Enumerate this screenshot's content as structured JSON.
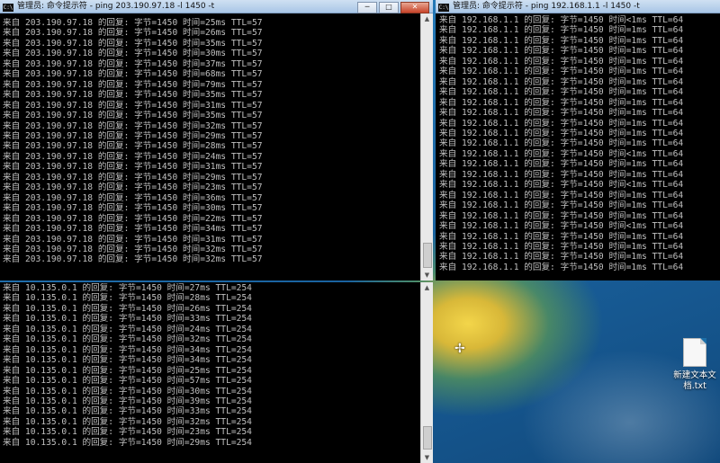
{
  "desktop": {
    "file_icon_label": "新建文本文档.txt",
    "cursor": "✢"
  },
  "icons": {
    "console": "C:\\",
    "minimize": "─",
    "maximize": "□",
    "close": "✕",
    "scroll_up": "▲",
    "scroll_down": "▼"
  },
  "window_left_top": {
    "title": "管理员: 命令提示符 - ping  203.190.97.18 -l 1450 -t",
    "lines": [
      "来自 203.190.97.18 的回复: 字节=1450 时间=25ms TTL=57",
      "来自 203.190.97.18 的回复: 字节=1450 时间=26ms TTL=57",
      "来自 203.190.97.18 的回复: 字节=1450 时间=35ms TTL=57",
      "来自 203.190.97.18 的回复: 字节=1450 时间=30ms TTL=57",
      "来自 203.190.97.18 的回复: 字节=1450 时间=37ms TTL=57",
      "来自 203.190.97.18 的回复: 字节=1450 时间=68ms TTL=57",
      "来自 203.190.97.18 的回复: 字节=1450 时间=79ms TTL=57",
      "来自 203.190.97.18 的回复: 字节=1450 时间=35ms TTL=57",
      "来自 203.190.97.18 的回复: 字节=1450 时间=31ms TTL=57",
      "来自 203.190.97.18 的回复: 字节=1450 时间=35ms TTL=57",
      "来自 203.190.97.18 的回复: 字节=1450 时间=32ms TTL=57",
      "来自 203.190.97.18 的回复: 字节=1450 时间=29ms TTL=57",
      "来自 203.190.97.18 的回复: 字节=1450 时间=28ms TTL=57",
      "来自 203.190.97.18 的回复: 字节=1450 时间=24ms TTL=57",
      "来自 203.190.97.18 的回复: 字节=1450 时间=31ms TTL=57",
      "来自 203.190.97.18 的回复: 字节=1450 时间=29ms TTL=57",
      "来自 203.190.97.18 的回复: 字节=1450 时间=23ms TTL=57",
      "来自 203.190.97.18 的回复: 字节=1450 时间=36ms TTL=57",
      "来自 203.190.97.18 的回复: 字节=1450 时间=30ms TTL=57",
      "来自 203.190.97.18 的回复: 字节=1450 时间=22ms TTL=57",
      "来自 203.190.97.18 的回复: 字节=1450 时间=34ms TTL=57",
      "来自 203.190.97.18 的回复: 字节=1450 时间=31ms TTL=57",
      "来自 203.190.97.18 的回复: 字节=1450 时间=32ms TTL=57",
      "来自 203.190.97.18 的回复: 字节=1450 时间=32ms TTL=57"
    ]
  },
  "window_right": {
    "title": "管理员: 命令提示符 - ping  192.168.1.1 -l 1450 -t",
    "lines": [
      "来自 192.168.1.1 的回复: 字节=1450 时间<1ms TTL=64",
      "来自 192.168.1.1 的回复: 字节=1450 时间=1ms TTL=64",
      "来自 192.168.1.1 的回复: 字节=1450 时间=1ms TTL=64",
      "来自 192.168.1.1 的回复: 字节=1450 时间=1ms TTL=64",
      "来自 192.168.1.1 的回复: 字节=1450 时间=1ms TTL=64",
      "来自 192.168.1.1 的回复: 字节=1450 时间=1ms TTL=64",
      "来自 192.168.1.1 的回复: 字节=1450 时间=1ms TTL=64",
      "来自 192.168.1.1 的回复: 字节=1450 时间=1ms TTL=64",
      "来自 192.168.1.1 的回复: 字节=1450 时间=1ms TTL=64",
      "来自 192.168.1.1 的回复: 字节=1450 时间=1ms TTL=64",
      "来自 192.168.1.1 的回复: 字节=1450 时间=1ms TTL=64",
      "来自 192.168.1.1 的回复: 字节=1450 时间=1ms TTL=64",
      "来自 192.168.1.1 的回复: 字节=1450 时间=1ms TTL=64",
      "来自 192.168.1.1 的回复: 字节=1450 时间<1ms TTL=64",
      "来自 192.168.1.1 的回复: 字节=1450 时间=1ms TTL=64",
      "来自 192.168.1.1 的回复: 字节=1450 时间=1ms TTL=64",
      "来自 192.168.1.1 的回复: 字节=1450 时间<1ms TTL=64",
      "来自 192.168.1.1 的回复: 字节=1450 时间=1ms TTL=64",
      "来自 192.168.1.1 的回复: 字节=1450 时间=1ms TTL=64",
      "来自 192.168.1.1 的回复: 字节=1450 时间=1ms TTL=64",
      "来自 192.168.1.1 的回复: 字节=1450 时间<1ms TTL=64",
      "来自 192.168.1.1 的回复: 字节=1450 时间=1ms TTL=64",
      "来自 192.168.1.1 的回复: 字节=1450 时间=1ms TTL=64",
      "来自 192.168.1.1 的回复: 字节=1450 时间=1ms TTL=64",
      "来自 192.168.1.1 的回复: 字节=1450 时间=1ms TTL=64"
    ]
  },
  "window_left_bottom": {
    "lines": [
      "来自 10.135.0.1 的回复: 字节=1450 时间=27ms TTL=254",
      "来自 10.135.0.1 的回复: 字节=1450 时间=28ms TTL=254",
      "来自 10.135.0.1 的回复: 字节=1450 时间=26ms TTL=254",
      "来自 10.135.0.1 的回复: 字节=1450 时间=33ms TTL=254",
      "来自 10.135.0.1 的回复: 字节=1450 时间=24ms TTL=254",
      "来自 10.135.0.1 的回复: 字节=1450 时间=32ms TTL=254",
      "来自 10.135.0.1 的回复: 字节=1450 时间=34ms TTL=254",
      "来自 10.135.0.1 的回复: 字节=1450 时间=34ms TTL=254",
      "来自 10.135.0.1 的回复: 字节=1450 时间=25ms TTL=254",
      "来自 10.135.0.1 的回复: 字节=1450 时间=57ms TTL=254",
      "来自 10.135.0.1 的回复: 字节=1450 时间=30ms TTL=254",
      "来自 10.135.0.1 的回复: 字节=1450 时间=39ms TTL=254",
      "来自 10.135.0.1 的回复: 字节=1450 时间=33ms TTL=254",
      "来自 10.135.0.1 的回复: 字节=1450 时间=32ms TTL=254",
      "来自 10.135.0.1 的回复: 字节=1450 时间=23ms TTL=254",
      "来自 10.135.0.1 的回复: 字节=1450 时间=29ms TTL=254"
    ]
  }
}
